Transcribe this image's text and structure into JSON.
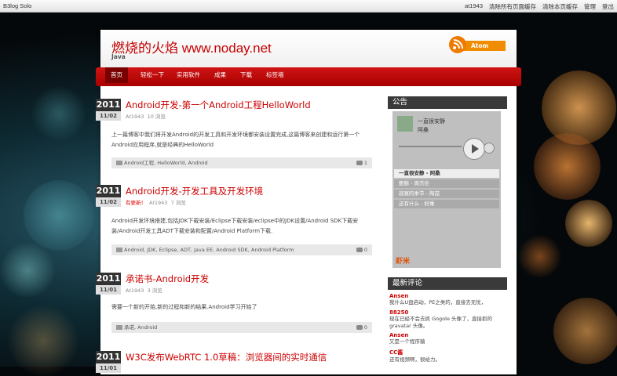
{
  "topbar": {
    "brand": "B3log Solo",
    "links": [
      "at1943",
      "清除所有页面缓存",
      "清除本页缓存",
      "管理",
      "登出"
    ]
  },
  "site": {
    "title": "燃烧的火焰 www.noday.net",
    "subtitle": "Java",
    "feed": "Atom"
  },
  "nav": [
    "首页",
    "轻松一下",
    "实用软件",
    "成果",
    "下载",
    "标签墙"
  ],
  "posts": [
    {
      "year": "2011",
      "day": "11/02",
      "title": "Android开发-第一个Android工程HelloWorld",
      "author": "At1943",
      "views": "10 浏览",
      "badge": "",
      "excerpt": "上一篇博客中我们将开发Android的开发工具和开发环境都安装设置完成,这篇博客来创建和运行第一个Android应用程序,就是经典的HelloWorld",
      "tags": "Android工程, HelloWorld, Android",
      "comments": "1"
    },
    {
      "year": "2011",
      "day": "11/02",
      "title": "Android开发-开发工具及开发环境",
      "author": "At1943",
      "views": "7 浏览",
      "badge": "有更新！",
      "excerpt": "Android开发环境搭建,包括JDK下载安装/Eclipse下载安装/eclipse中的JDK设置/Android SDK下载安装/Android开发工具ADT下载安装和配置/Android Platform下载.",
      "tags": "Android, JDK, Eclipse, ADT, Java EE, Android SDK, Android Platform",
      "comments": "0"
    },
    {
      "year": "2011",
      "day": "11/01",
      "title": "承诺书-Android开发",
      "author": "At1943",
      "views": "3 浏览",
      "badge": "",
      "excerpt": "需要一个新的开始,新的过程和新的结果.Android学习开始了",
      "tags": "承诺, Android",
      "comments": "0"
    },
    {
      "year": "2011",
      "day": "11/01",
      "title": "W3C发布WebRTC 1.0草稿：浏览器间的实时通信",
      "author": "",
      "views": "",
      "badge": "",
      "excerpt": "",
      "tags": "",
      "comments": ""
    }
  ],
  "sidebar": {
    "notice_title": "公告",
    "player": {
      "song": "一直很安静",
      "artist": "阿桑",
      "playlist": [
        "一直很安静 - 阿桑",
        "鲍鲸 - 周杰伦",
        "寂寞的季节 - 陶喆",
        "还有什么 - 好乘"
      ],
      "brand": "虾米"
    },
    "comments_title": "最新评论",
    "comments": [
      {
        "name": "Ansen",
        "text": "我什么U盘启动，PE之类的，直接去无忧，"
      },
      {
        "name": "88250",
        "text": "现在已经不会去抓 Gogole 头像了，直接抓的 gravatar 头像。"
      },
      {
        "name": "Ansen",
        "text": "又是一个程序猿"
      },
      {
        "name": "CC酱",
        "text": "还有视频啊，很给力。"
      }
    ]
  }
}
